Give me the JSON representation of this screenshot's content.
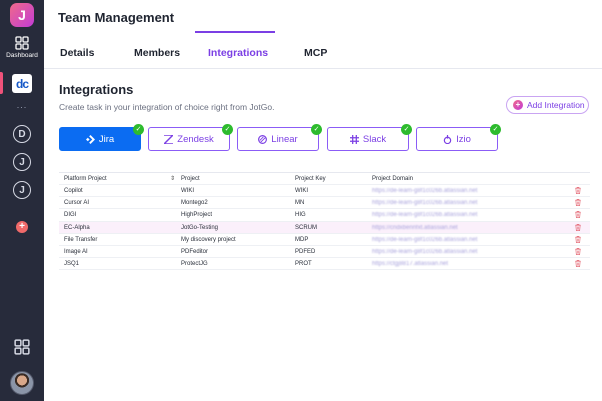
{
  "sidebar": {
    "logo_letter": "J",
    "dashboard_label": "Dashboard",
    "workspace_badge": "dc",
    "more_dots": "...",
    "workspace_letters": [
      "D",
      "J",
      "J"
    ],
    "add_symbol": "+"
  },
  "header": {
    "title": "Team Management"
  },
  "tabs": [
    {
      "label": "Details"
    },
    {
      "label": "Members"
    },
    {
      "label": "Integrations"
    },
    {
      "label": "MCP"
    }
  ],
  "section": {
    "title": "Integrations",
    "subtitle": "Create task in your integration of choice right from JotGo.",
    "add_button": "Add Integration"
  },
  "integrations": [
    {
      "name": "Jira",
      "icon": "jira-icon",
      "selected": true,
      "connected": true
    },
    {
      "name": "Zendesk",
      "icon": "zendesk-icon",
      "selected": false,
      "connected": true
    },
    {
      "name": "Linear",
      "icon": "linear-icon",
      "selected": false,
      "connected": true
    },
    {
      "name": "Slack",
      "icon": "slack-icon",
      "selected": false,
      "connected": true
    },
    {
      "name": "Izio",
      "icon": "izio-icon",
      "selected": false,
      "connected": true
    }
  ],
  "table": {
    "columns": [
      "Platform Project",
      "Project",
      "Project Key",
      "Project Domain"
    ],
    "rows": [
      {
        "platform": "Copilot",
        "project": "WIKI",
        "key": "WIKI",
        "domain": "https://de-learn-g8f1c026b.atlassian.net"
      },
      {
        "platform": "Cursor AI",
        "project": "Montego2",
        "key": "MN",
        "domain": "https://de-learn-g8f1c026b.atlassian.net"
      },
      {
        "platform": "DIGI",
        "project": "HighProject",
        "key": "HIG",
        "domain": "https://de-learn-g8f1c026b.atlassian.net"
      },
      {
        "platform": "EC-Alpha",
        "project": "JotGo-Testing",
        "key": "SCRUM",
        "domain": "https://cndxbennfxt.atlassian.net"
      },
      {
        "platform": "File Transfer",
        "project": "My discovery project",
        "key": "MDP",
        "domain": "https://de-learn-g8f1c026b.atlassian.net"
      },
      {
        "platform": "Image AI",
        "project": "PDFeditor",
        "key": "PDFED",
        "domain": "https://de-learn-g8f1c026b.atlassian.net"
      },
      {
        "platform": "JSQ1",
        "project": "ProtectJG",
        "key": "PROT",
        "domain": "https://ctgj8817.atlassian.net"
      }
    ]
  },
  "colors": {
    "accent": "#7b3fe4",
    "selected": "#0b6cf2",
    "sidebar": "#272b3b",
    "check": "#2dbb2d",
    "delete": "#e05260"
  }
}
